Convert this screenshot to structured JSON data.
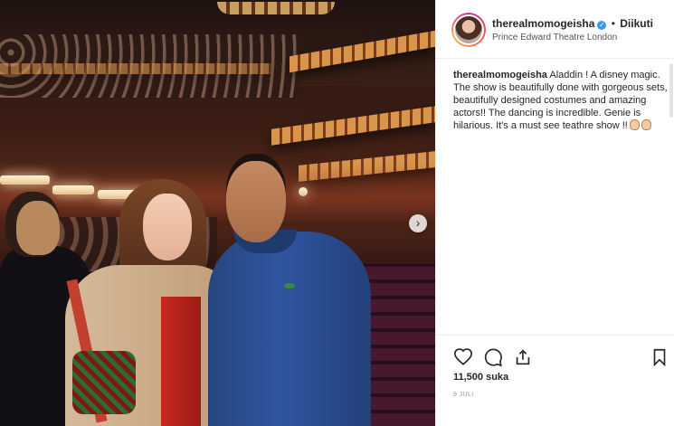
{
  "post": {
    "username": "therealmomogeisha",
    "verified_icon": "verified-badge-icon",
    "separator": "•",
    "follow_status": "Diikuti",
    "location": "Prince Edward Theatre London",
    "caption_user": "therealmomogeisha",
    "caption_text": "Aladdin ! A disney magic. The show is beautifully done with gorgeous sets, beautifully designed costumes and amazing actors!! The dancing is incredible. Genie is hilarious. It's a must see teathre show !!",
    "caption_emojis": [
      "clapping-hands-emoji",
      "clapping-hands-emoji"
    ],
    "likes": "11,500 suka",
    "date": "9 JULI"
  },
  "actions": {
    "icons": [
      "heart-icon",
      "comment-icon",
      "share-icon",
      "bookmark-icon"
    ]
  },
  "photo": {
    "next_label": "›"
  },
  "colors": {
    "accent_blue": "#3897f0",
    "text_primary": "#262626",
    "text_muted": "#999999",
    "border": "#efefef"
  }
}
